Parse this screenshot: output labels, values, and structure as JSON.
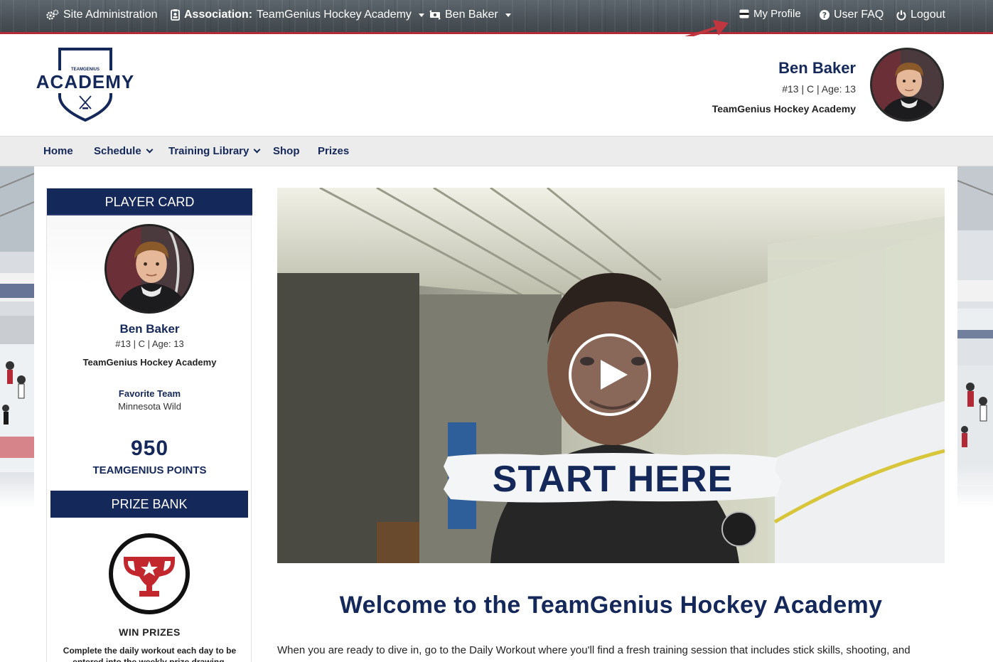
{
  "topbar": {
    "site_admin": "Site Administration",
    "association_label": "Association:",
    "association_value": "TeamGenius Hockey Academy",
    "user": "Ben Baker",
    "my_profile": "My Profile",
    "user_faq": "User FAQ",
    "logout": "Logout"
  },
  "logo": {
    "brand_small": "TEAMGENIUS",
    "brand_big": "ACADEMY"
  },
  "profile": {
    "name": "Ben Baker",
    "meta": "#13 | C | Age: 13",
    "team": "TeamGenius Hockey Academy"
  },
  "nav": {
    "items": [
      {
        "label": "Home"
      },
      {
        "label": "Schedule"
      },
      {
        "label": "Training Library"
      },
      {
        "label": "Shop"
      },
      {
        "label": "Prizes"
      }
    ]
  },
  "player_card": {
    "header": "PLAYER CARD",
    "name": "Ben Baker",
    "meta": "#13 | C | Age: 13",
    "team": "TeamGenius Hockey Academy",
    "favorite_label": "Favorite Team",
    "favorite_value": "Minnesota Wild",
    "points": "950",
    "points_label": "TEAMGENIUS POINTS",
    "prize_bank_header": "PRIZE BANK",
    "win_title": "WIN PRIZES",
    "win_desc": "Complete the daily workout each day to be entered into the weekly prize drawing."
  },
  "video": {
    "overlay_text": "START HERE"
  },
  "main": {
    "welcome": "Welcome to the TeamGenius Hockey Academy",
    "intro": "When you are ready to dive in, go to the Daily Workout where you'll find a fresh training session that includes stick skills, shooting, and"
  },
  "colors": {
    "navy": "#14285a",
    "accent_red": "#b22a35",
    "topbar": "#4a5258"
  },
  "icons": {
    "site_admin": "gears-icon",
    "association": "badge-icon",
    "user_switch": "exchange-icon",
    "my_profile": "id-card-icon",
    "faq": "question-circle-icon",
    "logout": "power-icon",
    "play": "play-icon",
    "trophy": "trophy-icon"
  }
}
